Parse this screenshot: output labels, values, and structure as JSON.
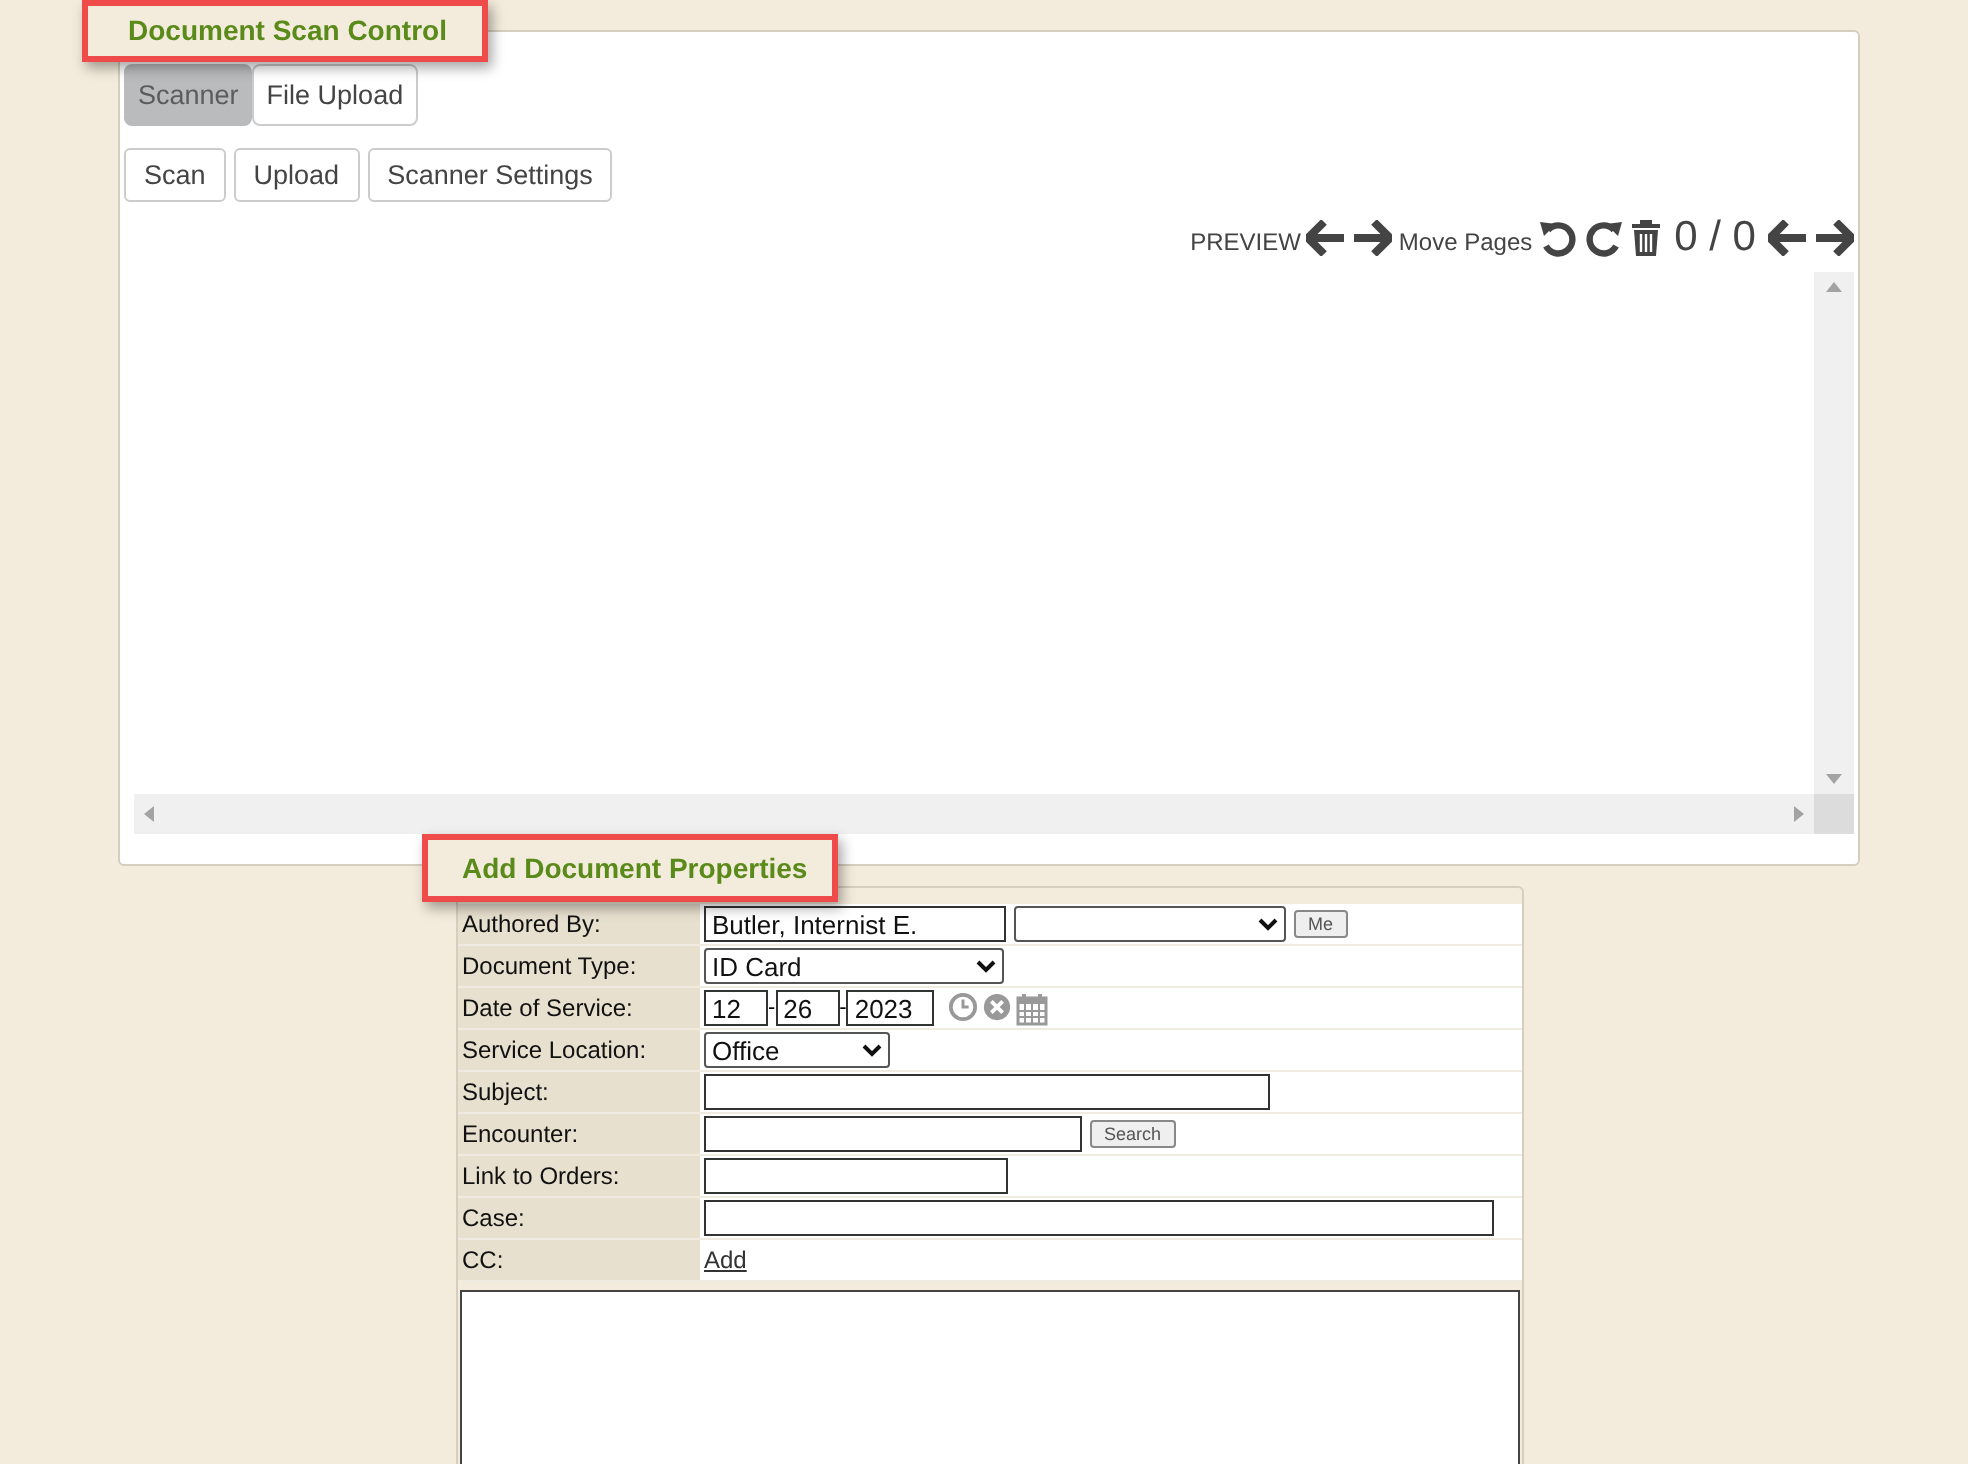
{
  "scan_control": {
    "title": "Document Scan Control",
    "highlighted": true,
    "tabs": [
      {
        "label": "Scanner",
        "selected": true
      },
      {
        "label": "File Upload",
        "selected": false
      }
    ],
    "buttons": [
      "Scan",
      "Upload",
      "Scanner Settings"
    ],
    "toolbar": {
      "preview_label": "PREVIEW",
      "move_label": "Move Pages",
      "page_counter": "0 / 0"
    }
  },
  "properties": {
    "title": "Add Document Properties",
    "highlighted": true,
    "fields": [
      {
        "label": "Authored By:",
        "kind": "author",
        "value": "Butler, Internist E.",
        "button": "Me"
      },
      {
        "label": "Document Type:",
        "kind": "select",
        "value": "ID Card"
      },
      {
        "label": "Date of Service:",
        "kind": "date",
        "month": "12",
        "day": "26",
        "year": "2023",
        "separator": "-"
      },
      {
        "label": "Service Location:",
        "kind": "select",
        "value": "Office"
      },
      {
        "label": "Subject:",
        "kind": "text"
      },
      {
        "label": "Encounter:",
        "kind": "search",
        "button": "Search"
      },
      {
        "label": "Link to Orders:",
        "kind": "text"
      },
      {
        "label": "Case:",
        "kind": "text"
      },
      {
        "label": "CC:",
        "kind": "link",
        "link": "Add"
      }
    ]
  }
}
